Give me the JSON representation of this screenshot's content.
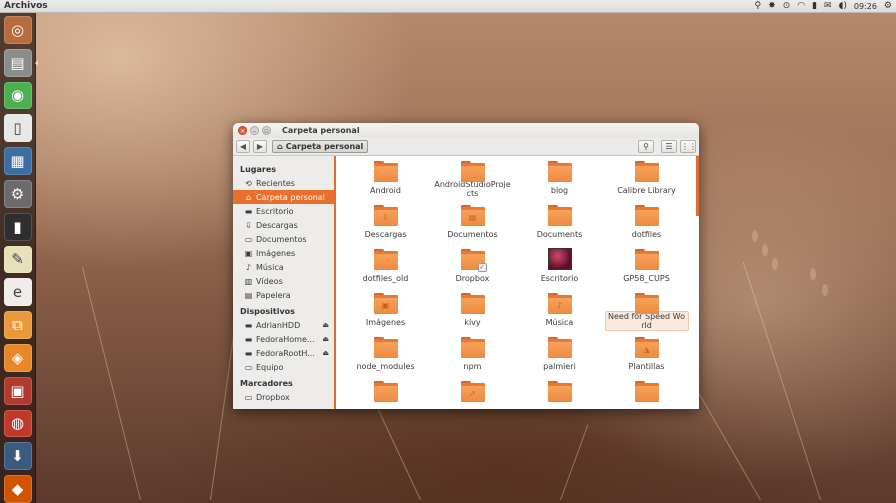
{
  "top_panel": {
    "app_title": "Archivos",
    "indicators": [
      "⚲",
      "✸",
      "⊙",
      "✉",
      "◖)"
    ],
    "clock": "09:26"
  },
  "launcher": {
    "items": [
      {
        "name": "ubuntu-home-icon",
        "glyph": "◎",
        "bg": "#b86b3f"
      },
      {
        "name": "files-icon",
        "glyph": "▤",
        "bg": "#8c8c8c"
      },
      {
        "name": "chrome-icon",
        "glyph": "◉",
        "bg": "#4caf50"
      },
      {
        "name": "text-editor-icon",
        "glyph": "▯",
        "bg": "#e8e8e8"
      },
      {
        "name": "writer-icon",
        "glyph": "▦",
        "bg": "#3a6ea5"
      },
      {
        "name": "settings-icon",
        "glyph": "⚙",
        "bg": "#6b6b6b"
      },
      {
        "name": "terminal-icon",
        "glyph": "▮",
        "bg": "#2e2e2e"
      },
      {
        "name": "notes-icon",
        "glyph": "✎",
        "bg": "#e8e0b8"
      },
      {
        "name": "emacs-icon",
        "glyph": "e",
        "bg": "#f0ece8"
      },
      {
        "name": "network-icon",
        "glyph": "⧉",
        "bg": "#e89a3a"
      },
      {
        "name": "sublime-icon",
        "glyph": "◈",
        "bg": "#e8872a"
      },
      {
        "name": "monitor-icon",
        "glyph": "▣",
        "bg": "#b03a2e"
      },
      {
        "name": "lifesaver-icon",
        "glyph": "◍",
        "bg": "#c0392b"
      },
      {
        "name": "apps-icon",
        "glyph": "⬇",
        "bg": "#3b5a80"
      },
      {
        "name": "store-icon",
        "glyph": "◆",
        "bg": "#d35400"
      }
    ]
  },
  "window": {
    "title": "Carpeta personal",
    "path_label": "Carpeta personal",
    "back": "◀",
    "forward": "▶",
    "search": "⚲",
    "list_view": "☰",
    "grid_view": "⋮⋮"
  },
  "sidebar": {
    "places_header": "Lugares",
    "places": [
      {
        "icon": "⟲",
        "label": "Recientes",
        "active": false
      },
      {
        "icon": "⌂",
        "label": "Carpeta personal",
        "active": true
      },
      {
        "icon": "▬",
        "label": "Escritorio",
        "active": false
      },
      {
        "icon": "⇩",
        "label": "Descargas",
        "active": false
      },
      {
        "icon": "▭",
        "label": "Documentos",
        "active": false
      },
      {
        "icon": "▣",
        "label": "Imágenes",
        "active": false
      },
      {
        "icon": "♪",
        "label": "Música",
        "active": false
      },
      {
        "icon": "▥",
        "label": "Vídeos",
        "active": false
      },
      {
        "icon": "▤",
        "label": "Papelera",
        "active": false
      }
    ],
    "devices_header": "Dispositivos",
    "devices": [
      {
        "icon": "▬",
        "label": "AdrianHDD",
        "eject": "⏏"
      },
      {
        "icon": "▬",
        "label": "FedoraHome...",
        "eject": "⏏"
      },
      {
        "icon": "▬",
        "label": "FedoraRootH...",
        "eject": "⏏"
      },
      {
        "icon": "▭",
        "label": "Equipo",
        "eject": ""
      }
    ],
    "bookmarks_header": "Marcadores",
    "bookmarks": [
      {
        "icon": "▭",
        "label": "Dropbox"
      }
    ]
  },
  "files": [
    {
      "name": "Android",
      "type": "folder",
      "emblem": ""
    },
    {
      "name": "AndroidStudioProjects",
      "type": "folder",
      "emblem": ""
    },
    {
      "name": "blog",
      "type": "folder",
      "emblem": ""
    },
    {
      "name": "Calibre Library",
      "type": "folder",
      "emblem": ""
    },
    {
      "name": "Descargas",
      "type": "folder",
      "emblem": "⇩"
    },
    {
      "name": "Documentos",
      "type": "folder",
      "emblem": "▤"
    },
    {
      "name": "Documents",
      "type": "folder",
      "emblem": ""
    },
    {
      "name": "dotfiles",
      "type": "folder",
      "emblem": ""
    },
    {
      "name": "dotfiles_old",
      "type": "folder",
      "emblem": ""
    },
    {
      "name": "Dropbox",
      "type": "folder",
      "emblem": "",
      "badge": "✓"
    },
    {
      "name": "Escritorio",
      "type": "photo",
      "emblem": ""
    },
    {
      "name": "GP58_CUPS",
      "type": "folder",
      "emblem": ""
    },
    {
      "name": "Imágenes",
      "type": "folder",
      "emblem": "▣"
    },
    {
      "name": "kivy",
      "type": "folder",
      "emblem": ""
    },
    {
      "name": "Música",
      "type": "folder",
      "emblem": "♪"
    },
    {
      "name": "Need for Speed World",
      "type": "folder",
      "emblem": "",
      "selected": true
    },
    {
      "name": "node_modules",
      "type": "folder",
      "emblem": ""
    },
    {
      "name": "npm",
      "type": "folder",
      "emblem": ""
    },
    {
      "name": "palmieri",
      "type": "folder",
      "emblem": ""
    },
    {
      "name": "Plantillas",
      "type": "folder",
      "emblem": "◮"
    },
    {
      "name": "",
      "type": "folder",
      "emblem": ""
    },
    {
      "name": "",
      "type": "folder",
      "emblem": "↗"
    },
    {
      "name": "",
      "type": "folder",
      "emblem": ""
    },
    {
      "name": "",
      "type": "folder",
      "emblem": ""
    }
  ]
}
